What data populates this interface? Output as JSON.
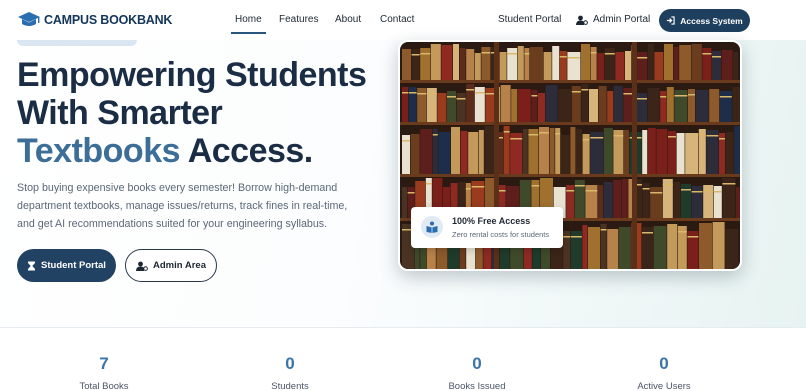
{
  "brand": {
    "name": "CAMPUS BOOKBANK",
    "icon": "graduation-cap-icon"
  },
  "nav": {
    "links": [
      {
        "label": "Home",
        "active": true
      },
      {
        "label": "Features",
        "active": false
      },
      {
        "label": "About",
        "active": false
      },
      {
        "label": "Contact",
        "active": false
      }
    ],
    "student_portal": "Student Portal",
    "admin_portal": "Admin Portal",
    "access_button": "Access System"
  },
  "hero": {
    "headline_line1": "Empowering Students",
    "headline_line2": "With Smarter",
    "headline_accent": "Textbooks",
    "headline_end": " Access.",
    "lead": "Stop buying expensive books every semester! Borrow high-demand department textbooks, manage issues/returns, track fines in real-time, and get AI recommendations suited for your engineering syllabus.",
    "primary_button": "Student Portal",
    "secondary_button": "Admin Area"
  },
  "image_card": {
    "title": "100% Free Access",
    "subtitle": "Zero rental costs for students"
  },
  "stats": [
    {
      "value": "7",
      "label": "Total Books"
    },
    {
      "value": "0",
      "label": "Students"
    },
    {
      "value": "0",
      "label": "Books Issued"
    },
    {
      "value": "0",
      "label": "Active Users"
    }
  ],
  "colors": {
    "primary": "#214263",
    "accent": "#3c6e98",
    "stat_value": "#3a74a8"
  }
}
